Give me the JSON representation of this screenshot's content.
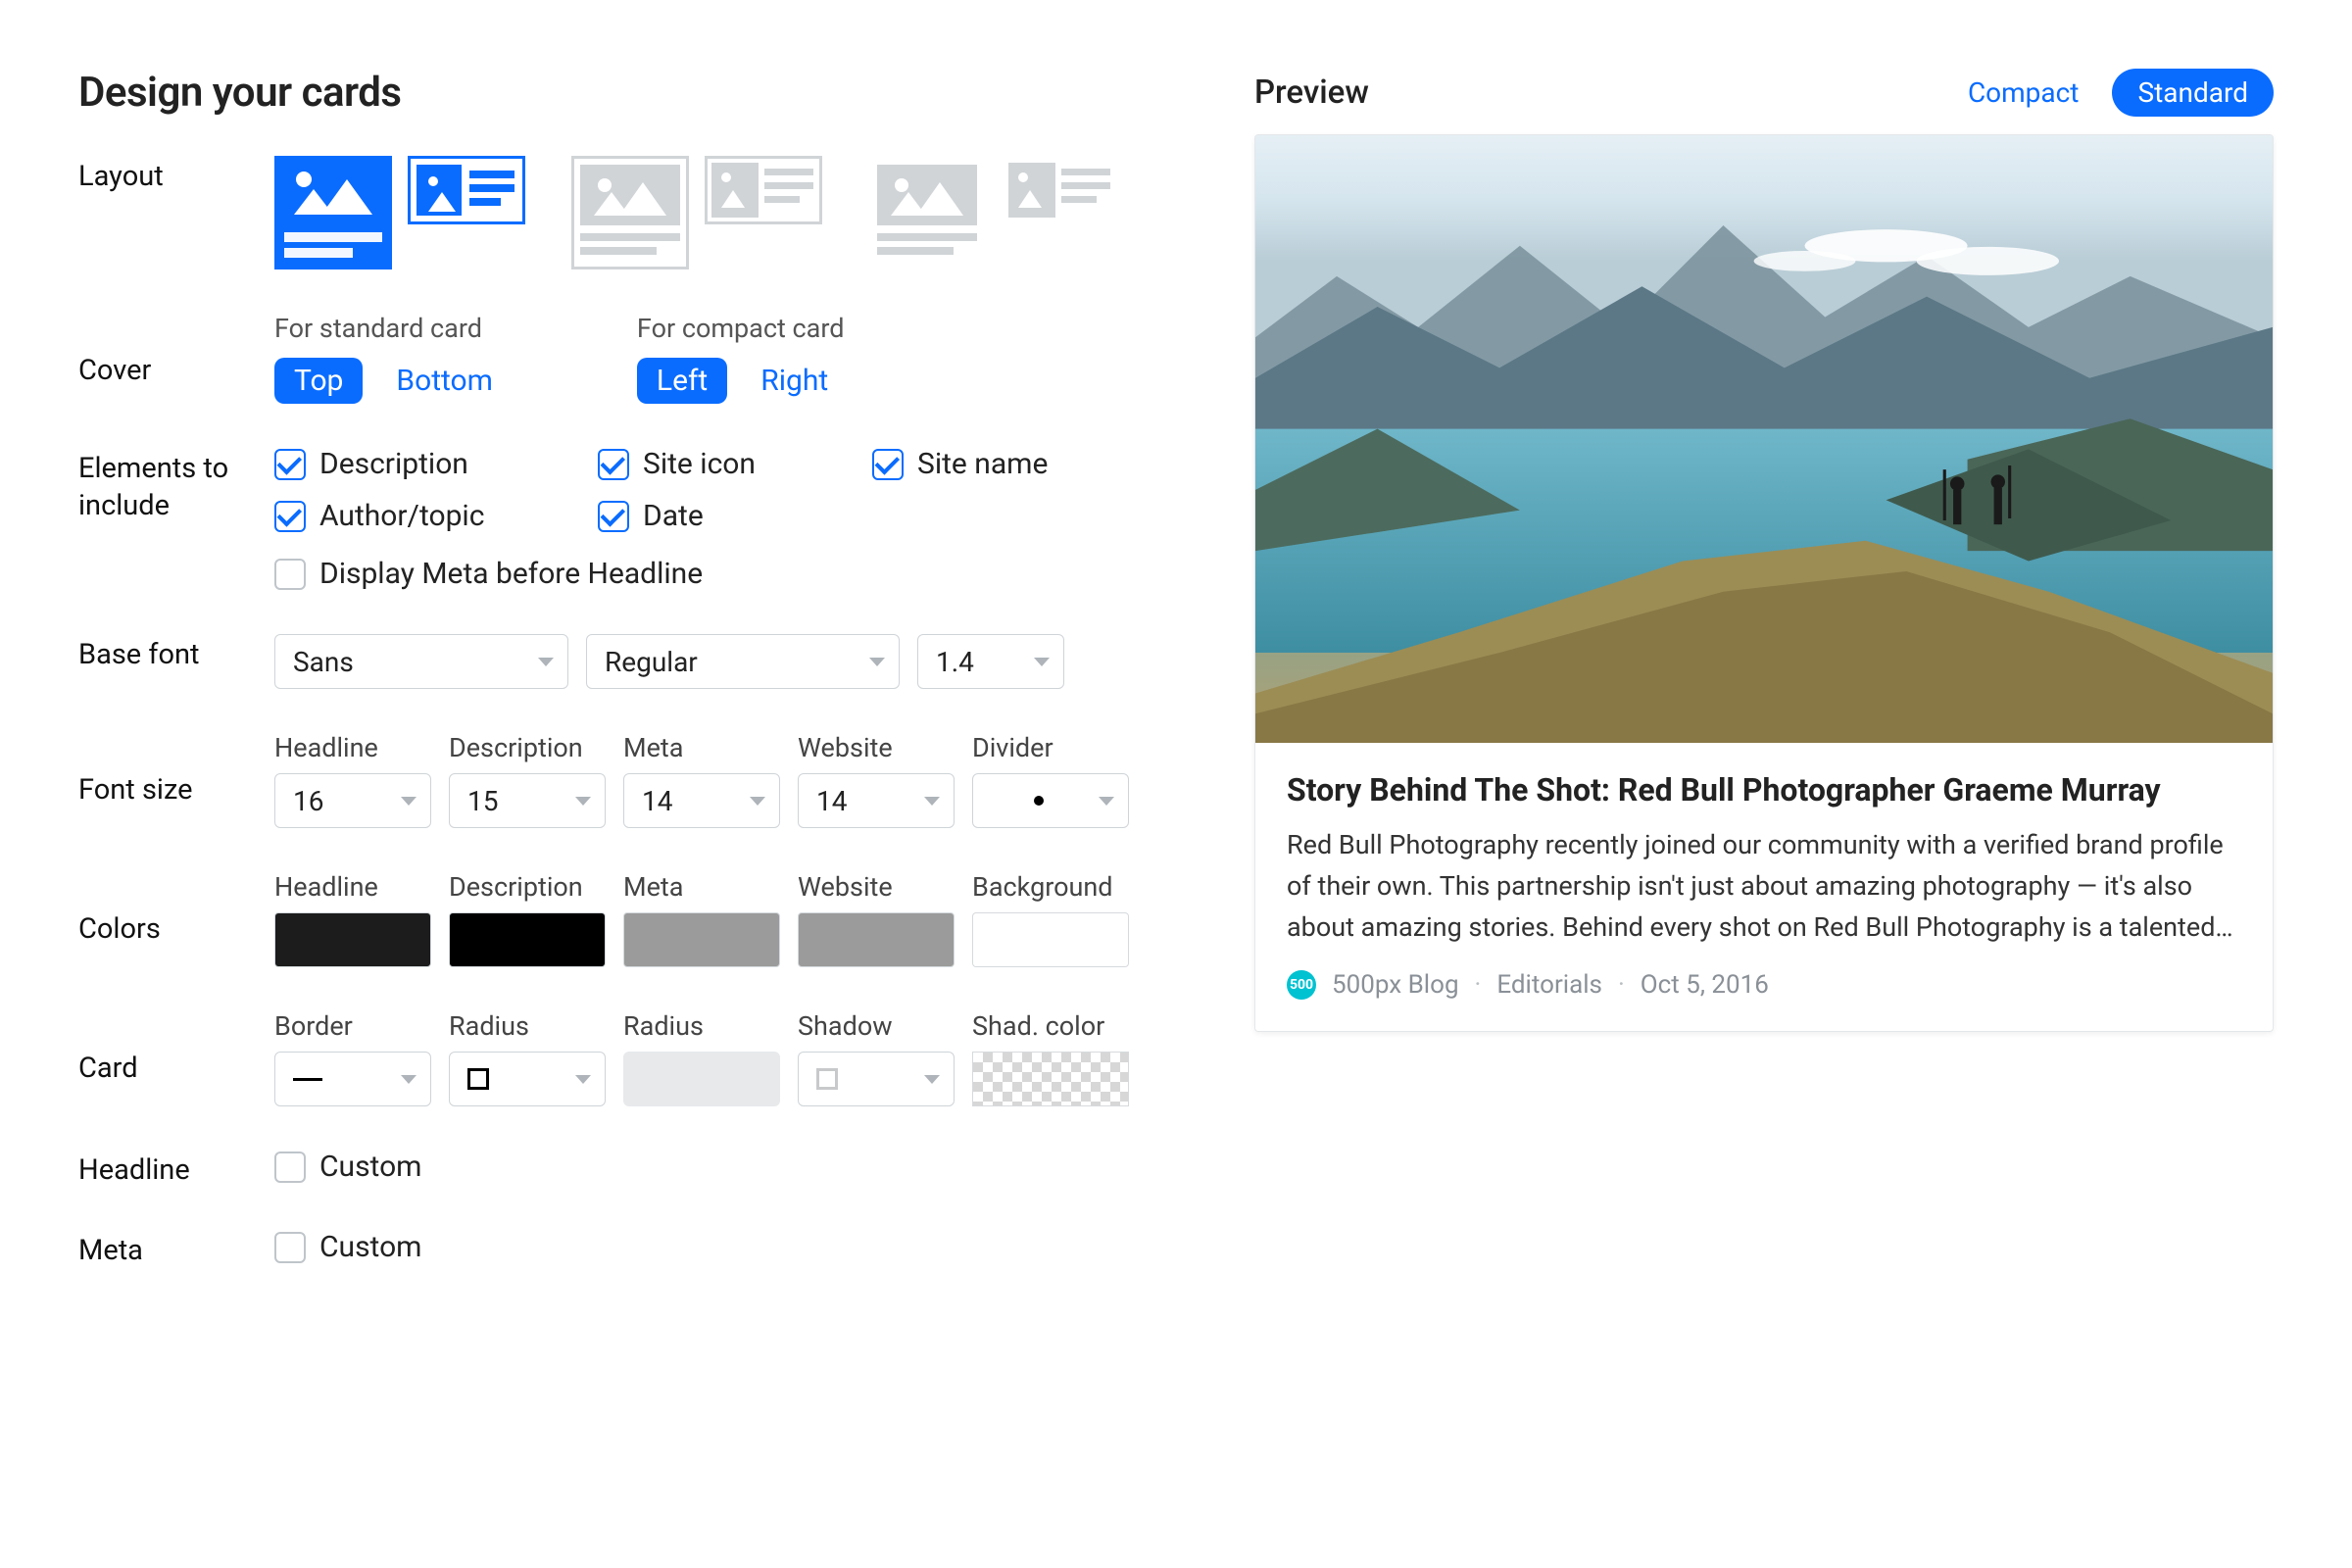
{
  "title": "Design your cards",
  "labels": {
    "layout": "Layout",
    "cover": "Cover",
    "elements": "Elements to include",
    "base_font": "Base font",
    "font_size": "Font size",
    "colors": "Colors",
    "card": "Card",
    "headline": "Headline",
    "meta": "Meta"
  },
  "cover": {
    "standard_caption": "For standard card",
    "compact_caption": "For compact card",
    "standard": {
      "top": "Top",
      "bottom": "Bottom",
      "selected": "top"
    },
    "compact": {
      "left": "Left",
      "right": "Right",
      "selected": "left"
    }
  },
  "elements": {
    "description": "Description",
    "site_icon": "Site icon",
    "site_name": "Site name",
    "author_topic": "Author/topic",
    "date": "Date",
    "display_meta_before_headline": "Display Meta before Headline"
  },
  "base_font": {
    "family": "Sans",
    "weight": "Regular",
    "line_height": "1.4"
  },
  "font_size": {
    "cols": {
      "headline": "Headline",
      "description": "Description",
      "meta": "Meta",
      "website": "Website",
      "divider": "Divider"
    },
    "headline": "16",
    "description": "15",
    "meta": "14",
    "website": "14",
    "divider": "•"
  },
  "colors": {
    "cols": {
      "headline": "Headline",
      "description": "Description",
      "meta": "Meta",
      "website": "Website",
      "background": "Background"
    },
    "headline": "#1c1c1c",
    "description": "#000000",
    "meta": "#9b9b9b",
    "website": "#9b9b9b",
    "background": "#ffffff"
  },
  "card_row": {
    "cols": {
      "border": "Border",
      "radius1": "Radius",
      "radius2": "Radius",
      "shadow": "Shadow",
      "shad_color": "Shad. color"
    }
  },
  "custom": {
    "label": "Custom"
  },
  "preview": {
    "title": "Preview",
    "compact": "Compact",
    "standard": "Standard",
    "card": {
      "headline": "Story Behind The Shot: Red Bull Photographer Graeme Murray",
      "description": "Red Bull Photography recently joined our community with a verified brand profile of their own. This partnership isn't just about amazing photography — it's also about amazing stories. Behind every shot on Red Bull Photography is a talented…",
      "site_name": "500px Blog",
      "topic": "Editorials",
      "date": "Oct 5, 2016"
    }
  }
}
